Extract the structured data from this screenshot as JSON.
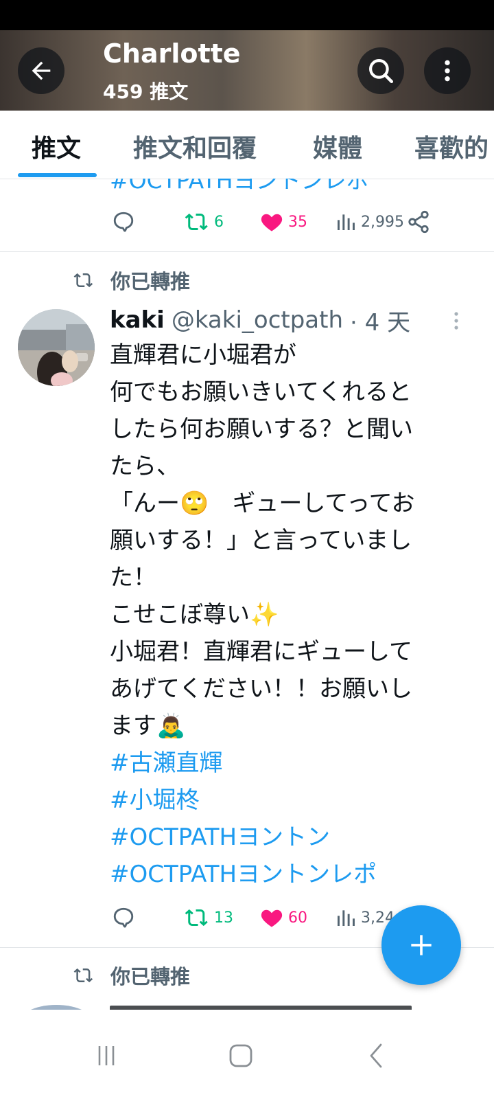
{
  "header": {
    "title": "Charlotte",
    "subtitle": "459 推文"
  },
  "tabs": [
    {
      "label": "推文",
      "active": true
    },
    {
      "label": "推文和回覆",
      "active": false
    },
    {
      "label": "媒體",
      "active": false
    },
    {
      "label": "喜歡的",
      "active": false
    }
  ],
  "previous_tweet": {
    "partial_text": "#OCTPATHヨントンレポ",
    "retweets": "6",
    "likes": "35",
    "views": "2,995"
  },
  "tweet": {
    "retweet_label": "你已轉推",
    "name": "kaki",
    "handle": "@kaki_octpath",
    "time": "· 4 天",
    "lines": [
      "直輝君に小堀君が",
      "何でもお願いきいてくれると",
      "したら何お願いする？と聞い",
      "たら、",
      "「んー🙄　ギューしてってお",
      "願いする！」と言っていまし",
      "た！",
      "こせこぼ尊い✨",
      "小堀君！直輝君にギューして",
      "あげてください！！お願いし",
      "ます🙇‍♂️"
    ],
    "hashtags": [
      "#古瀬直輝",
      "#小堀柊",
      "#OCTPATHヨントン",
      "#OCTPATHヨントンレポ"
    ],
    "retweets": "13",
    "likes": "60",
    "views": "3,24"
  },
  "next_tweet": {
    "retweet_label": "你已轉推"
  },
  "colors": {
    "accent": "#1d9bf0",
    "retweet_green": "#00ba7c",
    "like_pink": "#f91880",
    "secondary_text": "#536471"
  }
}
